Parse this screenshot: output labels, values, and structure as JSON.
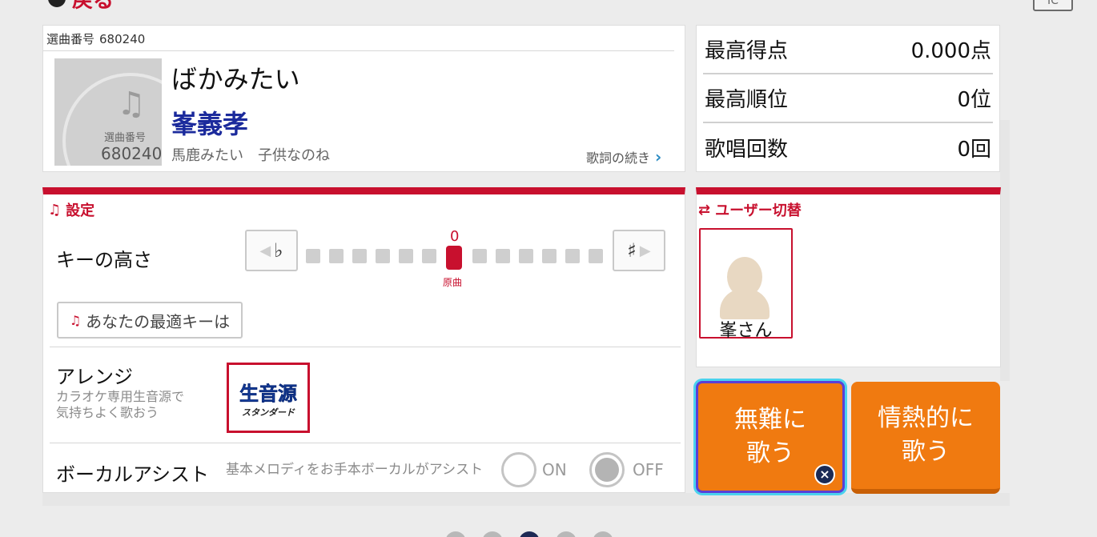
{
  "nav": {
    "back_label": "戻る",
    "corner_label": "IC"
  },
  "song": {
    "number_label": "選曲番号",
    "number": "680240",
    "thumb_label": "選曲番号",
    "thumb_number": "680240",
    "title": "ばかみたい",
    "artist": "峯義孝",
    "lyrics": "馬鹿みたい　子供なのね",
    "lyrics_more": "歌詞の続き"
  },
  "stats": [
    {
      "label": "最高得点",
      "value": "0.000点"
    },
    {
      "label": "最高順位",
      "value": "0位"
    },
    {
      "label": "歌唱回数",
      "value": "0回"
    }
  ],
  "settings": {
    "title": "設定",
    "key_label": "キーの高さ",
    "flat_symbol": "♭",
    "sharp_symbol": "♯",
    "key_value": "0",
    "original_label": "原曲",
    "optimal_key_button": "あなたの最適キーは",
    "arrange_label": "アレンジ",
    "arrange_desc_1": "カラオケ専用生音源で",
    "arrange_desc_2": "気持ちよく歌おう",
    "arrange_logo_main": "生音源",
    "arrange_logo_sub": "スタンダード",
    "vocal_assist_label": "ボーカルアシスト",
    "vocal_assist_desc": "基本メロディをお手本ボーカルがアシスト",
    "vocal_on": "ON",
    "vocal_off": "OFF",
    "vocal_selected": "OFF"
  },
  "user": {
    "title": "ユーザー切替",
    "name": "峯さん"
  },
  "actions": {
    "sing_easy_line1": "無難に",
    "sing_easy_line2": "歌う",
    "sing_passion_line1": "情熱的に",
    "sing_passion_line2": "歌う"
  },
  "colors": {
    "accent_red": "#c8102e",
    "sing_orange": "#f07a10",
    "artist_blue": "#1b2a9c",
    "focus_cyan": "#4ad2ee"
  }
}
